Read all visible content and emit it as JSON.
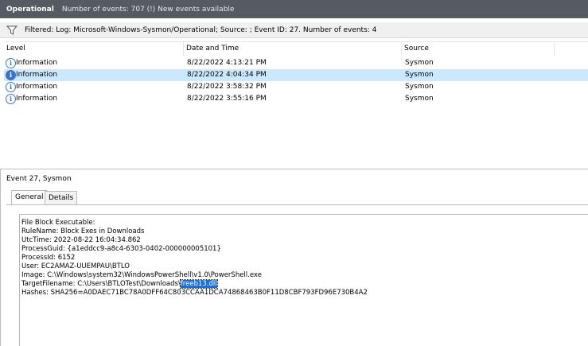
{
  "header": {
    "title": "Operational",
    "summary": "Number of events: 707 (!) New events available"
  },
  "filter": {
    "text": "Filtered: Log: Microsoft-Windows-Sysmon/Operational; Source: ; Event ID: 27. Number of events: 4"
  },
  "events_table": {
    "columns": [
      "Level",
      "Date and Time",
      "Source"
    ],
    "rows": [
      {
        "level": "Information",
        "datetime": "8/22/2022 4:13:21 PM",
        "source": "Sysmon",
        "selected": false
      },
      {
        "level": "Information",
        "datetime": "8/22/2022 4:04:34 PM",
        "source": "Sysmon",
        "selected": true
      },
      {
        "level": "Information",
        "datetime": "8/22/2022 3:58:32 PM",
        "source": "Sysmon",
        "selected": false
      },
      {
        "level": "Information",
        "datetime": "8/22/2022 3:55:16 PM",
        "source": "Sysmon",
        "selected": false
      }
    ]
  },
  "detail": {
    "title": "Event 27, Sysmon",
    "tabs": [
      "General",
      "Details"
    ],
    "lines": [
      "File Block Executable:",
      "RuleName: Block Exes in Downloads",
      "UtcTime: 2022-08-22 16:04:34.862",
      "ProcessGuid: {a1eddcc9-a8c4-6303-0402-000000005101}",
      "ProcessId: 6152",
      "User: EC2AMAZ-UUEMPAU\\BTLO",
      "Image: C:\\Windows\\system32\\WindowsPowerShell\\v1.0\\PowerShell.exe"
    ],
    "target_prefix": "TargetFilename: C:\\Users\\BTLOTest\\Downloads\\",
    "target_highlight": "freeb13.dll",
    "hashes": "Hashes: SHA256=A0DAEC71BC78A0DFF64C803CCAA1DCA74868463B0F11D8CBF793FD96E730B4A2"
  },
  "colors": {
    "header_bg": "#555b61",
    "selection": "#cce8ff",
    "highlight": "#1a6ed8",
    "info_icon": "#3b73c8"
  },
  "icons": {
    "filter": "filter-icon",
    "info": "info-icon"
  }
}
